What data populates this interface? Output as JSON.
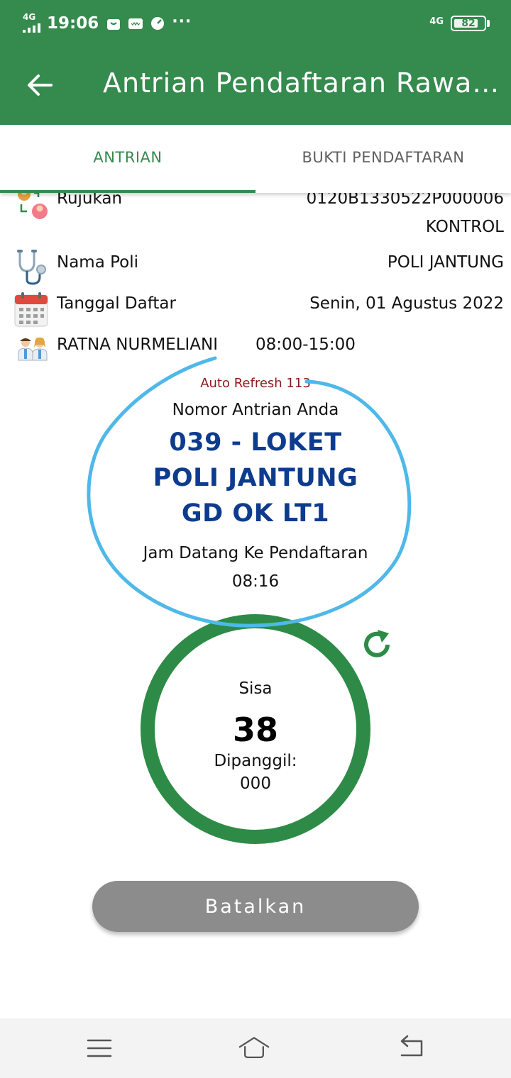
{
  "status_bar": {
    "network_left": "4G",
    "time": "19:06",
    "more_indicator": "···",
    "network_right": "4G",
    "battery": "82",
    "battery_level_percent": 82
  },
  "app_bar": {
    "title": "Antrian Pendaftaran Rawat Jalan",
    "back_icon": "arrow-left-icon"
  },
  "tabs": [
    {
      "label": "ANTRIAN",
      "active": true
    },
    {
      "label": "BUKTI PENDAFTARAN",
      "active": false
    }
  ],
  "info_rows": {
    "rujukan": {
      "label": "Rujukan",
      "value": "0120B1330522P000006",
      "value_line2": "KONTROL",
      "icon": "referral-icon"
    },
    "poli": {
      "label": "Nama Poli",
      "value": "POLI JANTUNG",
      "icon": "stethoscope-icon"
    },
    "tanggal": {
      "label": "Tanggal Daftar",
      "value": "Senin, 01 Agustus 2022",
      "icon": "calendar-icon"
    },
    "dokter": {
      "label": "RATNA NURMELIANI",
      "value": "08:00-15:00",
      "icon": "doctors-icon"
    }
  },
  "queue": {
    "auto_refresh": "Auto Refresh 113",
    "label": "Nomor Antrian Anda",
    "number_line1": "039 - LOKET",
    "number_line2": "POLI JANTUNG",
    "number_line3": "GD OK LT1",
    "arrival_label": "Jam Datang Ke Pendaftaran",
    "arrival_time": "08:16"
  },
  "remaining": {
    "sisa_label": "Sisa",
    "sisa_value": "38",
    "called_label": "Dipanggil:",
    "called_value": "000",
    "refresh_icon": "refresh-icon"
  },
  "actions": {
    "cancel_label": "Batalkan"
  },
  "nav_bar": {
    "menu_icon": "menu-icon",
    "home_icon": "home-icon",
    "back_icon": "back-icon"
  },
  "colors": {
    "primary_green": "#358a4e",
    "queue_blue": "#0d3b8e",
    "auto_refresh_red": "#8b1a1a",
    "annotation_blue": "#4fb8e8",
    "button_gray": "#8c8c8c"
  }
}
